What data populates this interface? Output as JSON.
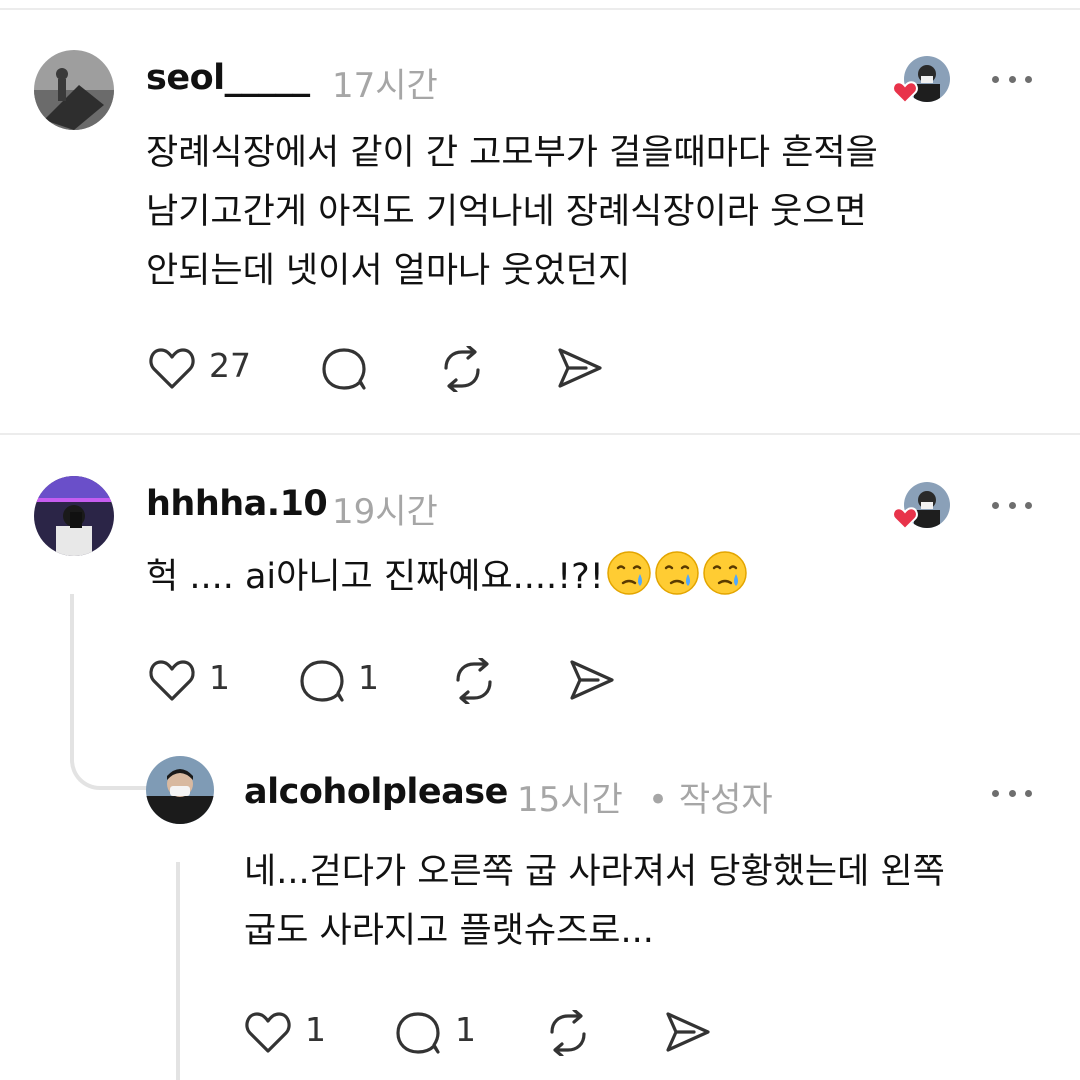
{
  "comments": [
    {
      "username": "seol_____",
      "time": "17시간",
      "text_lines": [
        "장례식장에서  같이 간 고모부가  걸을때마다 흔적을",
        "남기고간게  아직도 기억나네 장례식장이라 웃으면",
        "안되는데 넷이서 얼마나 웃었던지"
      ],
      "like_count": "27",
      "icons": [
        "heart-icon",
        "comment-icon",
        "repost-icon",
        "share-icon",
        "more-icon"
      ]
    },
    {
      "username": "hhhha.10",
      "time": "19시간",
      "text": "헉 .... ai아니고 진짜예요....!?!",
      "emoji": [
        "crying-face",
        "crying-face",
        "crying-face"
      ],
      "like_count": "1",
      "reply_count": "1"
    },
    {
      "username": "alcoholplease",
      "time": "15시간",
      "author_badge": "• 작성자",
      "text_lines": [
        "네...걷다가 오른쪽 굽 사라져서 당황했는데 왼쪽",
        "굽도 사라지고 플랫슈즈로..."
      ],
      "like_count": "1",
      "reply_count": "1"
    }
  ],
  "colors": {
    "text": "#111111",
    "muted": "#a6a6a6",
    "like_heart": "#e8334a",
    "divider": "#ececec"
  }
}
